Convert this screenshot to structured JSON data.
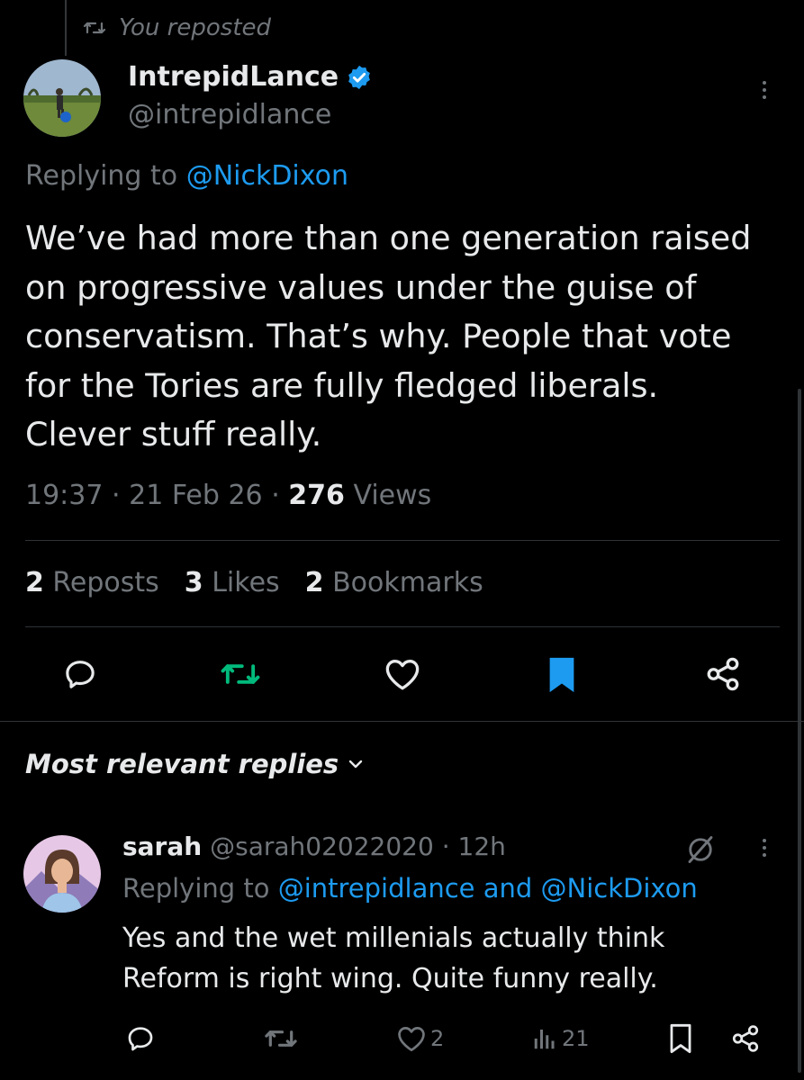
{
  "repost_context": {
    "label": "You reposted"
  },
  "post": {
    "display_name": "IntrepidLance",
    "handle": "@intrepidlance",
    "replying_prefix": "Replying to",
    "replying_to": "@NickDixon",
    "text": "We’ve had more than one generation raised\non progressive values under the guise of\nconservatism. That’s why. People that vote\nfor the Tories are fully fledged liberals.\nClever stuff really.",
    "time": "19:37",
    "date": "21 Feb 26",
    "views_count": "276",
    "views_label": "Views",
    "reposts_count": "2",
    "reposts_label": "Reposts",
    "likes_count": "3",
    "likes_label": "Likes",
    "bookmarks_count": "2",
    "bookmarks_label": "Bookmarks"
  },
  "replies_header": {
    "label": "Most relevant replies"
  },
  "reply": {
    "display_name": "sarah",
    "handle": "@sarah02022020",
    "age": "12h",
    "replying_prefix": "Replying to",
    "replying_to": "@intrepidlance and @NickDixon",
    "text": "Yes and the wet millenials actually think\nReform is right wing.  Quite funny really.",
    "likes_count": "2",
    "views_count": "21"
  },
  "colors": {
    "accent": "#1d9bf0",
    "repost_green": "#00ba7c",
    "muted": "#71767b"
  },
  "icons": [
    "repost-icon",
    "verified-badge-icon",
    "more-icon",
    "reply-icon",
    "like-icon",
    "bookmark-icon",
    "share-icon",
    "chevron-down-icon",
    "grok-icon",
    "views-icon"
  ]
}
